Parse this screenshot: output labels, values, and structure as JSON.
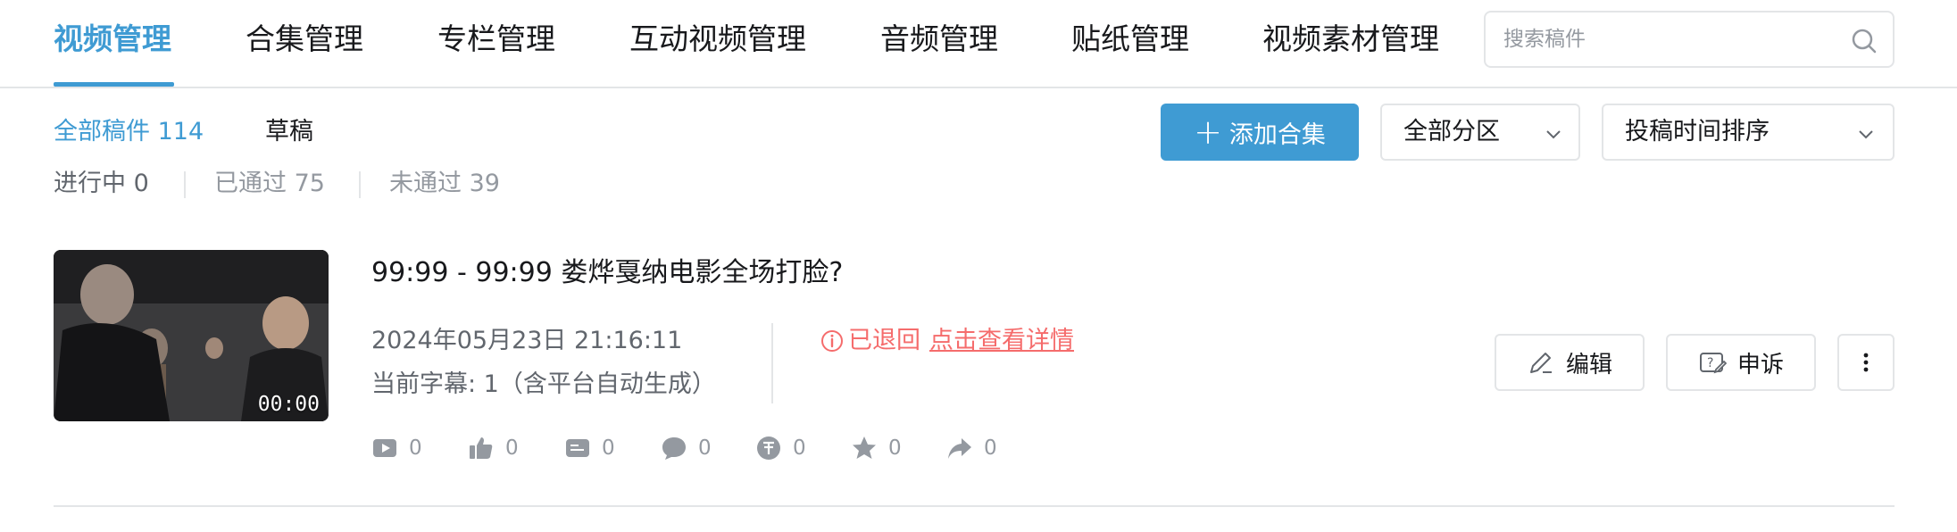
{
  "tabs": [
    {
      "label": "视频管理",
      "active": true
    },
    {
      "label": "合集管理"
    },
    {
      "label": "专栏管理"
    },
    {
      "label": "互动视频管理"
    },
    {
      "label": "音频管理"
    },
    {
      "label": "贴纸管理"
    },
    {
      "label": "视频素材管理"
    }
  ],
  "search": {
    "placeholder": "搜索稿件",
    "icon": "search-icon"
  },
  "filters": {
    "all": "全部稿件 114",
    "draft": "草稿"
  },
  "statuses": {
    "in_progress": "进行中 0",
    "passed": "已通过 75",
    "rejected": "未通过 39"
  },
  "toolbar": {
    "add_label": "添加合集",
    "zone_label": "全部分区",
    "sort_label": "投稿时间排序"
  },
  "item": {
    "duration": "00:00",
    "title": "99:99 - 99:99 娄烨戛纳电影全场打脸?",
    "date": "2024年05月23日 21:16:11",
    "subtitle_info": "当前字幕: 1（含平台自动生成）",
    "status_text": "已退回",
    "status_link": "点击查看详情",
    "stats": {
      "play": "0",
      "like": "0",
      "danmaku": "0",
      "comment": "0",
      "coin": "0",
      "favorite": "0",
      "share": "0"
    },
    "actions": {
      "edit": "编辑",
      "appeal": "申诉"
    }
  },
  "colors": {
    "accent": "#3f9bd3",
    "reject": "#f56c6c",
    "muted": "#9499a0",
    "border": "#e3e5e7"
  }
}
